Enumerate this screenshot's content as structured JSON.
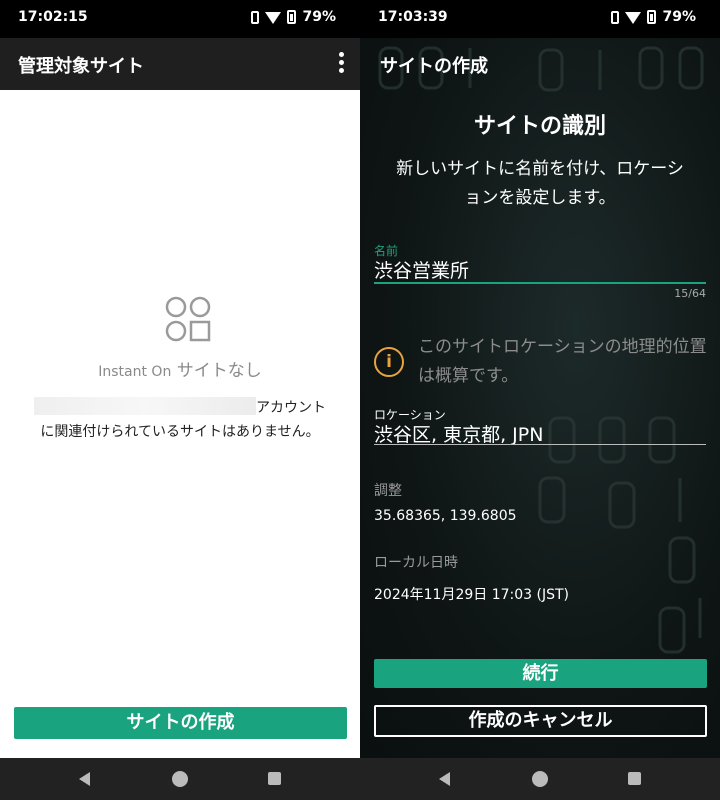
{
  "left": {
    "status_time": "17:02:15",
    "battery": "79%",
    "appbar_title": "管理対象サイト",
    "empty_brand": "Instant On",
    "empty_text": " サイトなし",
    "desc_after_redacted": "アカウント",
    "desc_rest": "に関連付けられているサイトはありません。",
    "create_button": "サイトの作成"
  },
  "right": {
    "status_time": "17:03:39",
    "battery": "79%",
    "appbar_title": "サイトの作成",
    "heading": "サイトの識別",
    "subtitle": "新しいサイトに名前を付け、ロケーションを設定します。",
    "name_label": "名前",
    "name_value": "渋谷営業所",
    "name_counter": "15/64",
    "info_icon_char": "i",
    "info_text": "このサイトロケーションの地理的位置は概算です。",
    "location_label": "ロケーション",
    "location_value": "渋谷区, 東京都, JPN",
    "adjust_label": "調整",
    "adjust_value": "35.68365, 139.6805",
    "local_time_label": "ローカル日時",
    "local_time_value": "2024年11月29日 17:03 (JST)",
    "continue_button": "続行",
    "cancel_button": "作成のキャンセル"
  },
  "colors": {
    "accent": "#1aa37f",
    "warning": "#e8a33c",
    "dark_bg": "#121212",
    "appbar_dark": "#1f1f1f"
  },
  "icons": [
    "vibrate-icon",
    "wifi-icon",
    "battery-icon",
    "overflow-menu-icon",
    "empty-sites-icon",
    "info-icon",
    "back-icon",
    "home-icon",
    "recents-icon"
  ]
}
